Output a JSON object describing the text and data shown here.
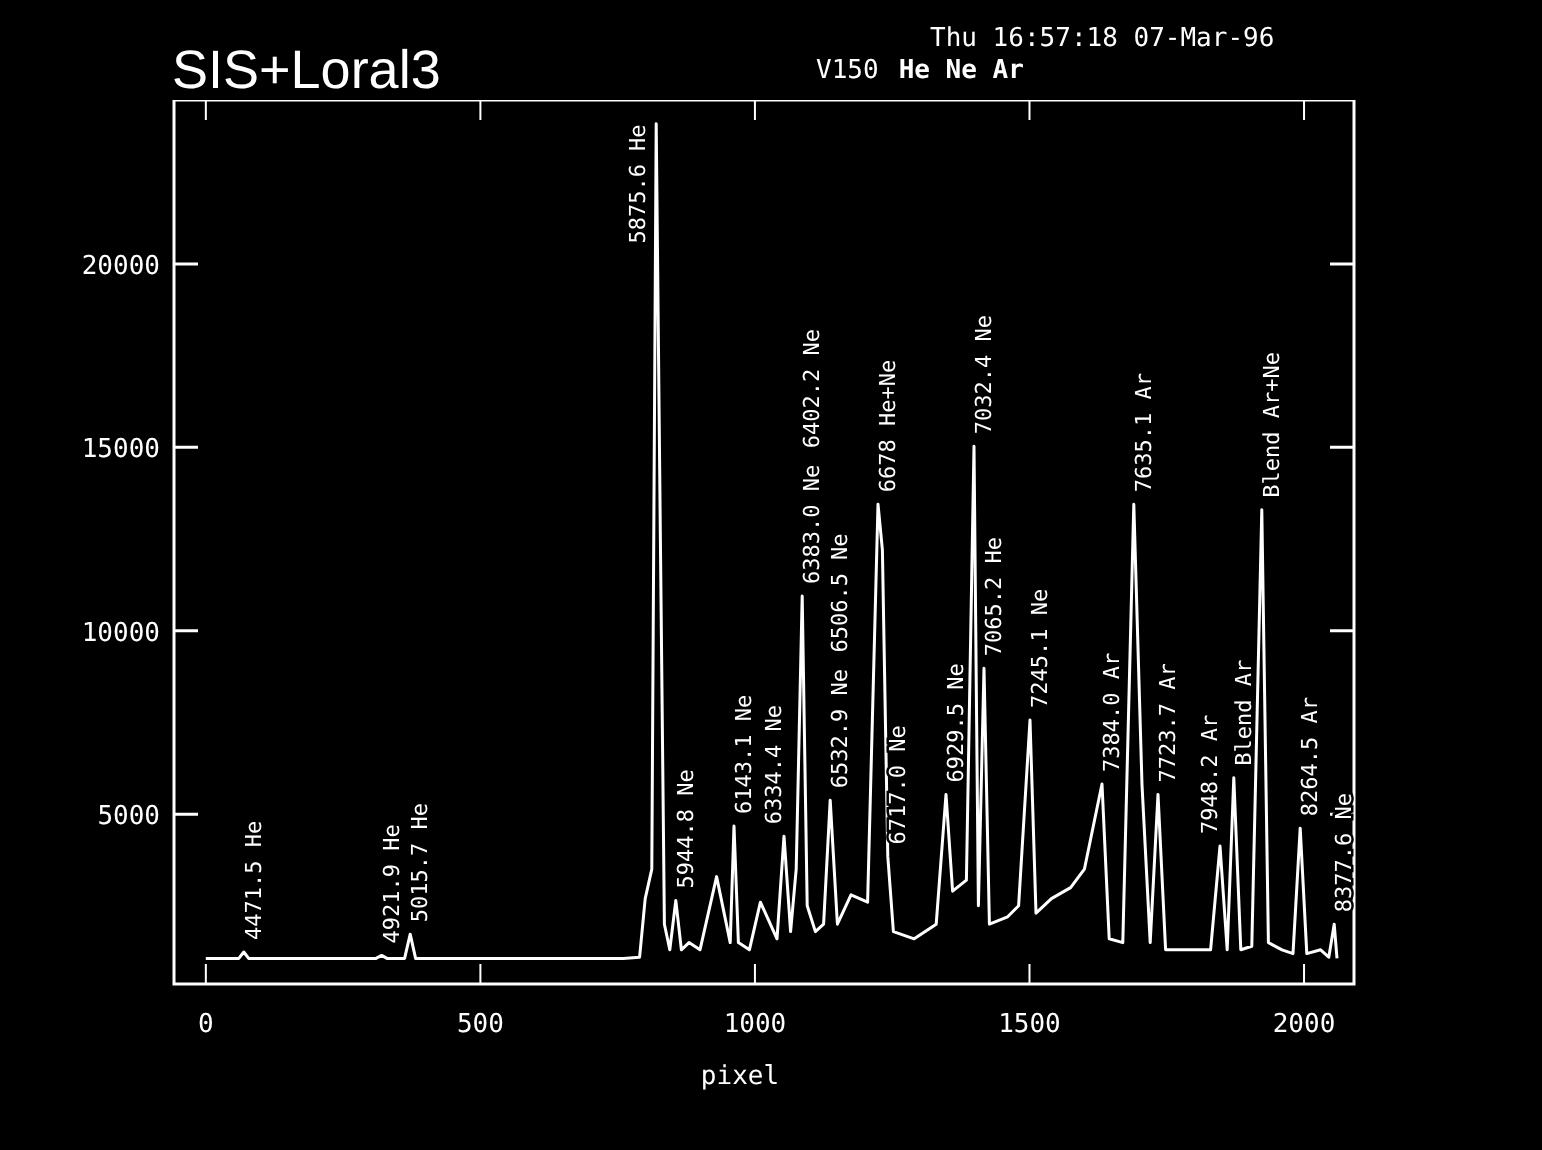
{
  "header": {
    "title": "SIS+Loral3",
    "timestamp": "Thu 16:57:18 07-Mar-96",
    "instrument": "V150",
    "lamps": "He Ne Ar"
  },
  "plot": {
    "chart_data": {
      "type": "line",
      "xlabel": "pixel",
      "xlim": [
        -58,
        2091
      ],
      "ylim": [
        370,
        24470
      ],
      "xticks": [
        0,
        500,
        1000,
        1500,
        2000
      ],
      "yticks": [
        5000,
        10000,
        15000,
        20000
      ],
      "x": [
        0,
        60,
        69,
        78,
        310,
        320,
        330,
        362,
        372,
        382,
        760,
        790,
        800,
        812,
        820,
        828,
        835,
        845,
        856,
        866,
        880,
        900,
        930,
        955,
        962,
        970,
        990,
        1010,
        1040,
        1053,
        1065,
        1075,
        1086,
        1095,
        1110,
        1125,
        1137,
        1150,
        1175,
        1205,
        1224,
        1232,
        1242,
        1252,
        1290,
        1330,
        1348,
        1360,
        1385,
        1399,
        1407,
        1417,
        1427,
        1460,
        1480,
        1501,
        1512,
        1540,
        1575,
        1600,
        1632,
        1645,
        1670,
        1690,
        1705,
        1720,
        1734,
        1748,
        1780,
        1830,
        1847,
        1860,
        1872,
        1885,
        1905,
        1923,
        1935,
        1960,
        1980,
        1993,
        2005,
        2030,
        2045,
        2055,
        2060
      ],
      "series": [
        {
          "color": "#ffffff",
          "values": [
            1070,
            1070,
            1240,
            1070,
            1070,
            1150,
            1070,
            1070,
            1730,
            1070,
            1070,
            1100,
            2700,
            3500,
            23820,
            12470,
            2000,
            1300,
            2650,
            1300,
            1500,
            1300,
            3300,
            1500,
            4680,
            1500,
            1300,
            2600,
            1600,
            4400,
            1800,
            3500,
            10950,
            2500,
            1800,
            2000,
            5380,
            2000,
            2800,
            2600,
            13450,
            12200,
            3850,
            1800,
            1600,
            2000,
            5540,
            2900,
            3200,
            15030,
            2500,
            8980,
            2000,
            2200,
            2500,
            7570,
            2300,
            2700,
            3000,
            3500,
            5820,
            1600,
            1500,
            13450,
            5800,
            1500,
            5540,
            1300,
            1300,
            1300,
            4130,
            1300,
            5990,
            1300,
            1400,
            13300,
            1500,
            1300,
            1200,
            4620,
            1200,
            1300,
            1100,
            2000,
            1070
          ]
        }
      ],
      "annotations": [
        {
          "x": 69,
          "y": 1240,
          "text": "4471.5 He"
        },
        {
          "x": 320,
          "y": 1150,
          "text": "4921.9 He"
        },
        {
          "x": 372,
          "y": 1730,
          "text": "5015.7 He"
        },
        {
          "x": 820,
          "y": 23820,
          "text": "5875.6 He"
        },
        {
          "x": 856,
          "y": 2650,
          "text": "5944.8 Ne"
        },
        {
          "x": 962,
          "y": 4680,
          "text": "6143.1 Ne"
        },
        {
          "x": 1053,
          "y": 4400,
          "text": "6334.4 Ne"
        },
        {
          "x": 1086,
          "y": 10950,
          "text": "6383.0 Ne"
        },
        "6402.2 Ne",
        {
          "x": 1137,
          "y": 5380,
          "text": "6532.9 Ne"
        },
        "6506.5 Ne",
        {
          "x": 1224,
          "y": 13450,
          "text": "6678 He+Ne"
        },
        {
          "x": 1242,
          "y": 3850,
          "text": "6717.0 Ne"
        },
        {
          "x": 1348,
          "y": 5540,
          "text": "6929.5 Ne"
        },
        {
          "x": 1399,
          "y": 15030,
          "text": "7032.4 Ne"
        },
        {
          "x": 1417,
          "y": 8980,
          "text": "7065.2 He"
        },
        {
          "x": 1501,
          "y": 7570,
          "text": "7245.1 Ne"
        },
        {
          "x": 1632,
          "y": 5820,
          "text": "7384.0 Ar"
        },
        {
          "x": 1690,
          "y": 13450,
          "text": "7635.1 Ar"
        },
        {
          "x": 1734,
          "y": 5540,
          "text": "7723.7 Ar"
        },
        {
          "x": 1847,
          "y": 4130,
          "text": "7948.2 Ar"
        },
        {
          "x": 1872,
          "y": 5990,
          "text": "Blend Ar"
        },
        {
          "x": 1923,
          "y": 13300,
          "text": "Blend Ar+Ne"
        },
        {
          "x": 1993,
          "y": 4620,
          "text": "8264.5 Ar"
        },
        {
          "x": 2055,
          "y": 2000,
          "text": "8377.6 Ne"
        }
      ]
    }
  }
}
